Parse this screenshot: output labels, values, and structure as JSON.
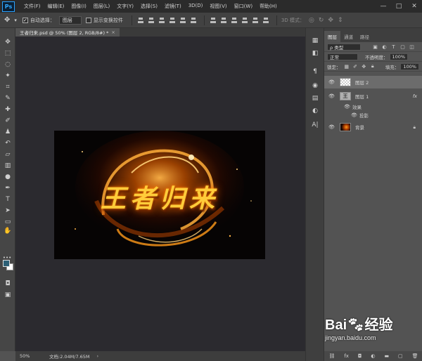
{
  "app": {
    "logo": "Ps"
  },
  "menu": [
    "文件(F)",
    "编辑(E)",
    "图像(I)",
    "图层(L)",
    "文字(Y)",
    "选择(S)",
    "滤镜(T)",
    "3D(D)",
    "视图(V)",
    "窗口(W)",
    "帮助(H)"
  ],
  "window_controls": {
    "minimize": "—",
    "maximize": "□",
    "close": "✕"
  },
  "options_bar": {
    "auto_select_label": "自动选择：",
    "auto_select_value": "图层",
    "show_transform_label": "显示变换控件",
    "mode_3d_label": "3D 模式："
  },
  "document": {
    "tab_title": "王者归来.psd @ 50% (图层 2, RGB/8#) *",
    "close": "×",
    "artwork_text": "王者归来"
  },
  "status": {
    "zoom": "50%",
    "doc_info": "文档:2.04M/7.65M",
    "arrow": "›"
  },
  "panel_tabs": [
    {
      "label": "图层",
      "active": true
    },
    {
      "label": "通道",
      "active": false
    },
    {
      "label": "路径",
      "active": false
    }
  ],
  "layers_panel": {
    "filter_kind": "ρ 类型",
    "blend_mode": "正常",
    "opacity_label": "不透明度：",
    "opacity_value": "100%",
    "lock_label": "锁定：",
    "fill_label": "填充：",
    "fill_value": "100%",
    "layers": [
      {
        "name": "图层 2",
        "selected": true,
        "thumb": "checker"
      },
      {
        "name": "图层 1",
        "selected": false,
        "thumb": "text",
        "fx": "fx"
      },
      {
        "name": "背景",
        "selected": false,
        "thumb": "bg",
        "locked": true
      }
    ],
    "effects_label": "效果",
    "effect_item": "投影",
    "bottom_icons": [
      "link-icon",
      "fx-icon",
      "mask-icon",
      "adjustment-icon",
      "folder-icon",
      "new-layer-icon",
      "trash-icon"
    ]
  },
  "watermark": {
    "logo_text": "Bai",
    "logo_after": "经验",
    "url": "jingyan.baidu.com"
  },
  "colors": {
    "accent": "#31a8ff",
    "foreground_swatch": "#2c5f75",
    "background_swatch": "#ffffff",
    "title_gold": "#ffcc3a"
  }
}
